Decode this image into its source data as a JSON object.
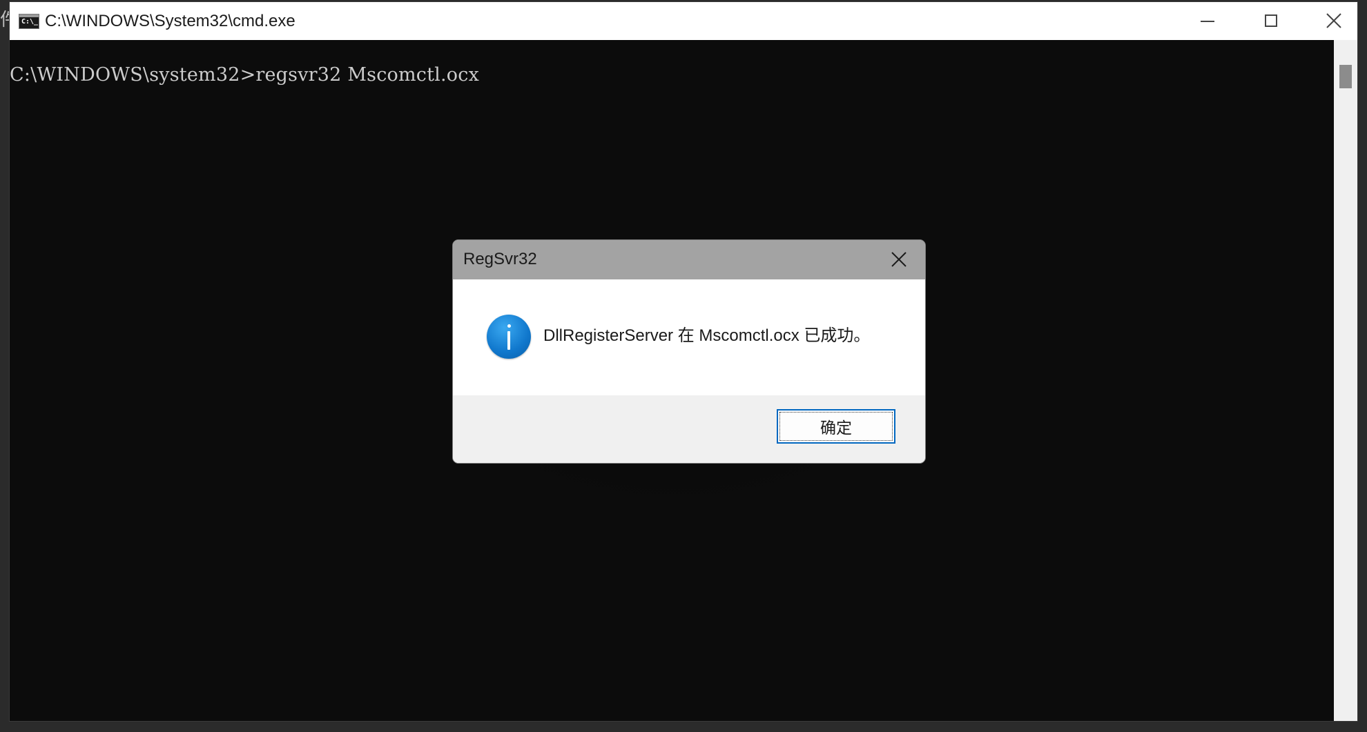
{
  "window": {
    "title": "C:\\WINDOWS\\System32\\cmd.exe",
    "icon": "console-app-icon",
    "icon_text": "C:\\_",
    "edge_glyph": "件"
  },
  "console": {
    "lines": [
      "C:\\WINDOWS\\system32>regsvr32 Mscomctl.ocx"
    ]
  },
  "dialog": {
    "title": "RegSvr32",
    "icon": "info-icon",
    "message": "DllRegisterServer 在 Mscomctl.ocx 已成功。",
    "ok_label": "确定"
  },
  "colors": {
    "console_bg": "#0c0c0c",
    "console_text": "#cccccc",
    "dialog_titlebar": "#a3a3a3",
    "dialog_footer": "#f0f0f0",
    "button_focus_border": "#0067c0",
    "info_icon_blue": "#1077cc"
  }
}
